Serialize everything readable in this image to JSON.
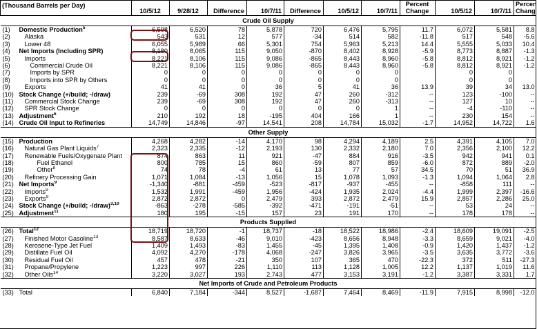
{
  "header": {
    "unit": "(Thousand Barrels per Day)",
    "columns": [
      "10/5/12",
      "9/28/12",
      "Difference",
      "10/7/11",
      "Difference",
      "10/5/12",
      "10/7/11",
      "Percent Change",
      "10/5/12",
      "10/7/11",
      "Percent Change"
    ]
  },
  "sections": [
    {
      "title": "Crude Oil Supply",
      "rows": [
        {
          "code": "(1)",
          "label": "Domestic Production",
          "sup": "5",
          "bold": true,
          "indent": 0,
          "v": [
            "6,598",
            "6,520",
            "78",
            "5,878",
            "720",
            "6,476",
            "5,795",
            "11.7",
            "6,072",
            "5,581",
            "8.8"
          ]
        },
        {
          "code": "(2)",
          "label": "Alaska",
          "indent": 1,
          "v": [
            "543",
            "531",
            "12",
            "577",
            "-34",
            "514",
            "582",
            "-11.8",
            "517",
            "548",
            "-5.6"
          ]
        },
        {
          "code": "(3)",
          "label": "Lower 48",
          "indent": 1,
          "v": [
            "6,055",
            "5,989",
            "66",
            "5,301",
            "754",
            "5,963",
            "5,213",
            "14.4",
            "5,555",
            "5,033",
            "10.4"
          ]
        },
        {
          "code": "(4)",
          "label": "Net Imports (Including SPR)",
          "bold": true,
          "indent": 0,
          "v": [
            "8,180",
            "8,065",
            "115",
            "9,050",
            "-870",
            "8,402",
            "8,928",
            "-5.9",
            "8,773",
            "8,887",
            "-1.3"
          ]
        },
        {
          "code": "(5)",
          "label": "Imports",
          "indent": 1,
          "v": [
            "8,221",
            "8,106",
            "115",
            "9,086",
            "-865",
            "8,443",
            "8,960",
            "-5.8",
            "8,812",
            "8,921",
            "-1.2"
          ]
        },
        {
          "code": "(6)",
          "label": "Commercial Crude Oil",
          "indent": 2,
          "v": [
            "8,221",
            "8,106",
            "115",
            "9,086",
            "-865",
            "8,443",
            "8,960",
            "-5.8",
            "8,812",
            "8,921",
            "-1.2"
          ]
        },
        {
          "code": "(7)",
          "label": "Imports by SPR",
          "indent": 2,
          "v": [
            "0",
            "0",
            "0",
            "0",
            "0",
            "0",
            "0",
            "",
            "0",
            "0",
            ""
          ]
        },
        {
          "code": "(8)",
          "label": "Imports into SPR by Others",
          "indent": 2,
          "v": [
            "0",
            "0",
            "0",
            "0",
            "0",
            "0",
            "0",
            "",
            "0",
            "0",
            ""
          ]
        },
        {
          "code": "(9)",
          "label": "Exports",
          "indent": 1,
          "v": [
            "41",
            "41",
            "0",
            "36",
            "5",
            "41",
            "36",
            "13.9",
            "39",
            "34",
            "13.0"
          ]
        },
        {
          "code": "(10)",
          "label": "Stock Change (+/build; -/draw)",
          "bold": true,
          "indent": 0,
          "v": [
            "239",
            "-69",
            "308",
            "192",
            "47",
            "260",
            "-312",
            "--",
            "123",
            "-100",
            "--"
          ]
        },
        {
          "code": "(11)",
          "label": "Commercial Stock Change",
          "indent": 1,
          "v": [
            "239",
            "-69",
            "308",
            "192",
            "47",
            "260",
            "-313",
            "--",
            "127",
            "10",
            "--"
          ]
        },
        {
          "code": "(12)",
          "label": "SPR Stock Change",
          "indent": 1,
          "v": [
            "0",
            "0",
            "0",
            "0",
            "0",
            "0",
            "1",
            "--",
            "-4",
            "-110",
            "--"
          ]
        },
        {
          "code": "(13)",
          "label": "Adjustment",
          "sup": "6",
          "bold": true,
          "indent": 0,
          "v": [
            "210",
            "192",
            "18",
            "-195",
            "404",
            "166",
            "1",
            "--",
            "230",
            "154",
            "--"
          ]
        },
        {
          "code": "(14)",
          "label": "Crude Oil Input to Refineries",
          "bold": true,
          "indent": 0,
          "v": [
            "14,749",
            "14,846",
            "-97",
            "14,541",
            "208",
            "14,784",
            "15,032",
            "-1.7",
            "14,952",
            "14,722",
            "1.6"
          ]
        }
      ]
    },
    {
      "title": "Other Supply",
      "rows": [
        {
          "code": "(15)",
          "label": "Production",
          "bold": true,
          "indent": 0,
          "v": [
            "4,268",
            "4,282",
            "-14",
            "4,170",
            "98",
            "4,294",
            "4,189",
            "2.5",
            "4,391",
            "4,105",
            "7.0"
          ]
        },
        {
          "code": "(16)",
          "label": "Natural Gas Plant Liquids",
          "sup": "7",
          "indent": 1,
          "v": [
            "2,323",
            "2,335",
            "-12",
            "2,193",
            "130",
            "2,332",
            "2,180",
            "7.0",
            "2,356",
            "2,100",
            "12.2"
          ]
        },
        {
          "code": "(17)",
          "label": "Renewable Fuels/Oxygenate Plant",
          "indent": 1,
          "v": [
            "874",
            "863",
            "11",
            "921",
            "-47",
            "884",
            "916",
            "-3.5",
            "942",
            "941",
            "0.1"
          ]
        },
        {
          "code": "(18)",
          "label": "Fuel Ethanol",
          "indent": 3,
          "v": [
            "800",
            "785",
            "15",
            "860",
            "-59",
            "807",
            "859",
            "-6.0",
            "872",
            "889",
            "-2.0"
          ]
        },
        {
          "code": "(19)",
          "label": "Other",
          "sup": "8",
          "indent": 3,
          "v": [
            "74",
            "78",
            "-4",
            "61",
            "13",
            "77",
            "57",
            "34.5",
            "70",
            "51",
            "36.9"
          ]
        },
        {
          "code": "(20)",
          "label": "Refinery Processing Gain",
          "indent": 1,
          "v": [
            "1,071",
            "1,084",
            "-13",
            "1,056",
            "15",
            "1,078",
            "1,093",
            "-1.3",
            "1,094",
            "1,064",
            "2.8"
          ]
        },
        {
          "code": "(21)",
          "label": "Net Imports",
          "sup": "9",
          "bold": true,
          "indent": 0,
          "v": [
            "-1,340",
            "-881",
            "-459",
            "-523",
            "-817",
            "-937",
            "-455",
            "--",
            "-858",
            "111",
            "--"
          ]
        },
        {
          "code": "(22)",
          "label": "Imports",
          "sup": "9",
          "indent": 1,
          "v": [
            "1,532",
            "1,991",
            "-459",
            "1,956",
            "-424",
            "1,935",
            "2,024",
            "-4.4",
            "1,999",
            "2,397",
            "-16.6"
          ]
        },
        {
          "code": "(23)",
          "label": "Exports",
          "sup": "9",
          "indent": 1,
          "v": [
            "2,872",
            "2,872",
            "0",
            "2,479",
            "393",
            "2,872",
            "2,479",
            "15.9",
            "2,857",
            "2,286",
            "25.0"
          ]
        },
        {
          "code": "(24)",
          "label": "Stock Change (+/build; -/draw)",
          "sup": "3,10",
          "bold": true,
          "indent": 0,
          "v": [
            "-863",
            "-278",
            "-585",
            "-392",
            "-471",
            "-191",
            "-51",
            "--",
            "53",
            "24",
            "--"
          ]
        },
        {
          "code": "(25)",
          "label": "Adjustment",
          "sup": "11",
          "bold": true,
          "indent": 0,
          "v": [
            "180",
            "195",
            "-15",
            "157",
            "23",
            "191",
            "170",
            "--",
            "178",
            "178",
            "--"
          ]
        }
      ]
    },
    {
      "title": "Products Supplied",
      "rows": [
        {
          "code": "(26)",
          "label": "Total",
          "sup": "12",
          "bold": true,
          "indent": 0,
          "v": [
            "18,719",
            "18,720",
            "-1",
            "18,737",
            "-18",
            "18,522",
            "18,986",
            "-2.4",
            "18,609",
            "19,091",
            "-2.5"
          ]
        },
        {
          "code": "(27)",
          "label": "Finished Motor Gasoline",
          "sup": "13",
          "indent": 1,
          "v": [
            "8,587",
            "8,633",
            "-46",
            "9,010",
            "-423",
            "8,656",
            "8,948",
            "-3.3",
            "8,659",
            "9,021",
            "-4.0"
          ]
        },
        {
          "code": "(28)",
          "label": "Kerosene-Type Jet Fuel",
          "indent": 1,
          "v": [
            "1,409",
            "1,493",
            "-83",
            "1,455",
            "-45",
            "1,395",
            "1,408",
            "-0.9",
            "1,420",
            "1,437",
            "-1.2"
          ]
        },
        {
          "code": "(29)",
          "label": "Distillate Fuel Oil",
          "indent": 1,
          "v": [
            "4,092",
            "4,270",
            "-178",
            "4,068",
            "-247",
            "3,826",
            "3,965",
            "-3.5",
            "3,635",
            "3,772",
            "-3.6"
          ]
        },
        {
          "code": "(30)",
          "label": "Residual Fuel Oil",
          "indent": 1,
          "v": [
            "457",
            "478",
            "-21",
            "350",
            "107",
            "365",
            "470",
            "-22.3",
            "372",
            "511",
            "-27.3"
          ]
        },
        {
          "code": "(31)",
          "label": "Propane/Propylene",
          "indent": 1,
          "v": [
            "1,223",
            "997",
            "226",
            "1,110",
            "113",
            "1,128",
            "1,005",
            "12.2",
            "1,137",
            "1,019",
            "11.6"
          ]
        },
        {
          "code": "(32)",
          "label": "Other Oils",
          "sup": "14",
          "indent": 1,
          "v": [
            "3,220",
            "3,027",
            "193",
            "2,743",
            "477",
            "3,153",
            "3,191",
            "-1.2",
            "3,387",
            "3,331",
            "1.7"
          ]
        }
      ]
    },
    {
      "title": "Net Imports of Crude and Petroleum Products",
      "rows": [
        {
          "code": "(33)",
          "label": "Total",
          "bold": false,
          "indent": 0,
          "v": [
            "6,840",
            "7,184",
            "-344",
            "8,527",
            "-1,687",
            "7,464",
            "8,469",
            "-11.9",
            "7,915",
            "8,998",
            "-12.0"
          ]
        }
      ]
    }
  ],
  "highlights": [
    "domestic-production-value",
    "net-imports-value",
    "other-supply-block"
  ]
}
